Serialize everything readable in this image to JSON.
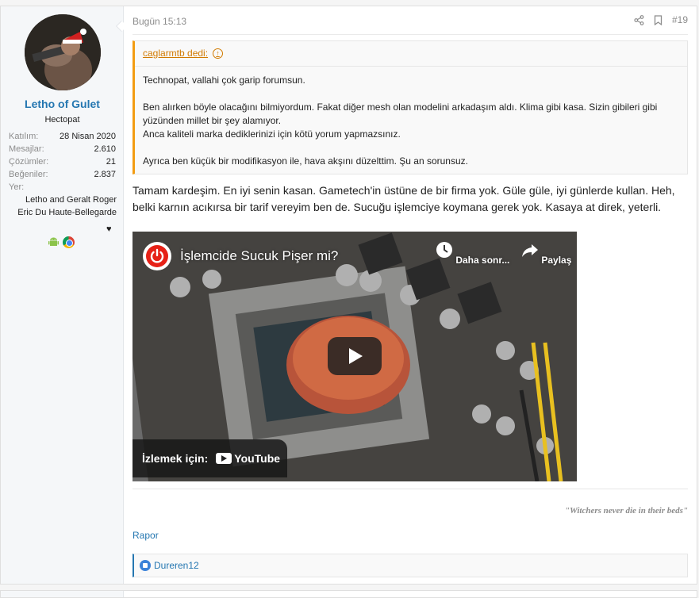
{
  "user": {
    "name": "Letho of Gulet",
    "title": "Hectopat",
    "stats": [
      {
        "label": "Katılım:",
        "value": "28 Nisan 2020"
      },
      {
        "label": "Mesajlar:",
        "value": "2.610"
      },
      {
        "label": "Çözümler:",
        "value": "21"
      },
      {
        "label": "Beğeniler:",
        "value": "2.837"
      },
      {
        "label": "Yer:",
        "value": ""
      }
    ],
    "location_line1": "Letho and Geralt Roger",
    "location_line2": "Eric Du Haute-Bellegarde",
    "heart": "♥",
    "devices": [
      "android-icon",
      "chrome-icon"
    ]
  },
  "post": {
    "date": "Bugün 15:13",
    "number": "#19",
    "quote": {
      "author": "caglarmtb dedi:",
      "lines": [
        "Technopat, vallahi çok garip forumsun.",
        "",
        "Ben alırken böyle olacağını bilmiyordum. Fakat diğer mesh olan modelini arkadaşım aldı. Klima gibi kasa. Sizin gibileri gibi yüzünden millet bir şey alamıyor.",
        "Anca kaliteli marka dediklerinizi için kötü yorum yapmazsınız.",
        "",
        "Ayrıca ben küçük bir modifikasyon ile, hava akşını düzelttim. Şu an sorunsuz."
      ]
    },
    "message": "Tamam kardeşim. En iyi senin kasan. Gametech'in üstüne de bir firma yok. Güle güle, iyi günlerde kullan. Heh, belki karnın acıkırsa bir tarif vereyim ben de. Sucuğu işlemciye koymana gerek yok. Kasaya at direk, yeterli.",
    "video": {
      "title": "İşlemcide Sucuk Pişer mi?",
      "later_label": "Daha sonr...",
      "share_label": "Paylaş",
      "watch_label": "İzlemek için:",
      "brand": "YouTube"
    },
    "signature": "\"Witchers never die in their beds\"",
    "report_label": "Rapor",
    "reaction_user": "Dureren12"
  },
  "colors": {
    "link": "#2577b1",
    "quote_accent": "#f39c12",
    "youtube_red": "#e62117"
  }
}
